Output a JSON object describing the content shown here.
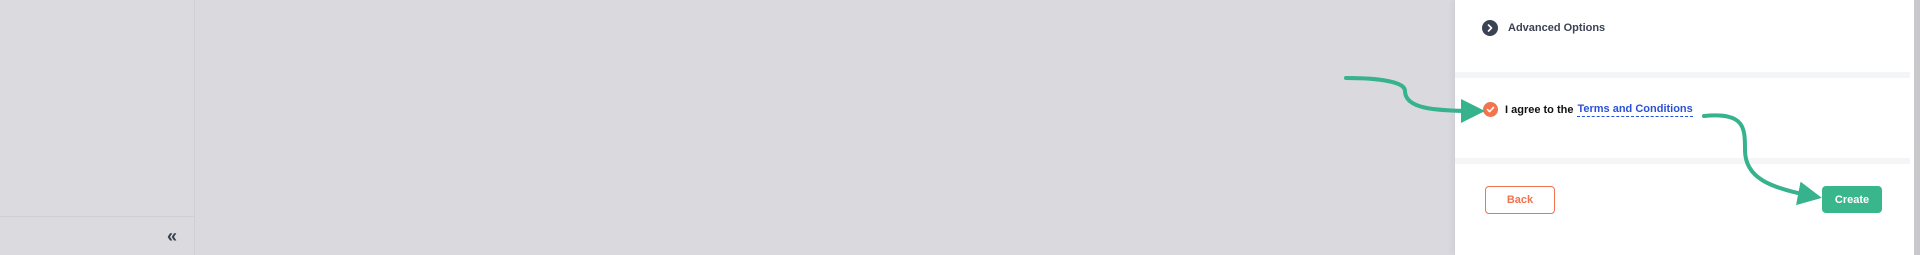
{
  "sidebar": {
    "collapse_glyph": "«",
    "collapse_icon": "double-chevron-left-icon"
  },
  "panel": {
    "advanced_options_label": "Advanced Options",
    "advanced_icon": "chevron-right-icon",
    "terms_prefix": "I agree to the",
    "terms_link": "Terms and Conditions",
    "terms_checked": true,
    "back_label": "Back",
    "create_label": "Create"
  },
  "colors": {
    "accent_orange": "#f2734f",
    "accent_green": "#3ab68c",
    "link_blue": "#2a52d6",
    "annotation_arrow": "#36b28d"
  }
}
